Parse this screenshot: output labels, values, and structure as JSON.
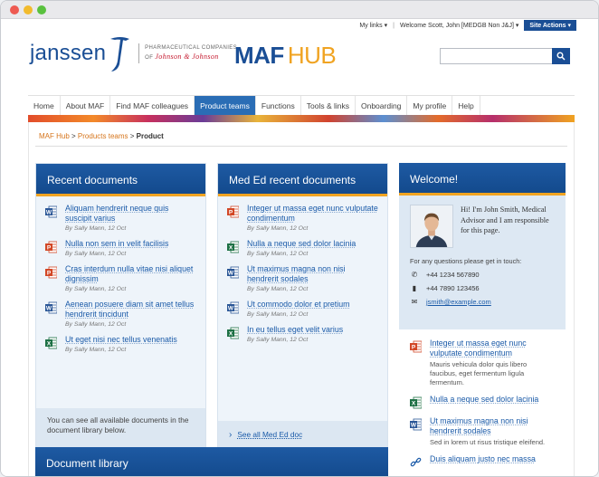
{
  "top": {
    "my_links": "My links ▾",
    "welcome": "Welcome Scott, John [MEDGB Non J&J] ▾",
    "site_actions": "Site Actions ▾"
  },
  "brand": {
    "company": "janssen",
    "pharma_line1": "PHARMACEUTICAL COMPANIES",
    "pharma_of": "OF",
    "jj": "Johnson & Johnson",
    "hub_maf": "MAF",
    "hub_hub": "HUB"
  },
  "search": {
    "placeholder": ""
  },
  "nav": [
    {
      "label": "Home"
    },
    {
      "label": "About MAF"
    },
    {
      "label": "Find MAF colleagues"
    },
    {
      "label": "Product teams"
    },
    {
      "label": "Functions"
    },
    {
      "label": "Tools & links"
    },
    {
      "label": "Onboarding"
    },
    {
      "label": "My profile"
    },
    {
      "label": "Help"
    }
  ],
  "breadcrumb": {
    "home": "MAF Hub",
    "sep1": " > ",
    "section": "Products teams",
    "sep2": " > ",
    "current": "Product"
  },
  "recent": {
    "title": "Recent documents",
    "items": [
      {
        "type": "word",
        "title": "Aliquam hendrerit neque quis suscipit varius",
        "meta": "By Sally Mann, 12 Oct"
      },
      {
        "type": "ppt",
        "title": "Nulla non sem in velit facilisis",
        "meta": "By Sally Mann, 12 Oct"
      },
      {
        "type": "ppt",
        "title": "Cras interdum nulla vitae nisi aliquet dignissim",
        "meta": "By Sally Mann, 12 Oct"
      },
      {
        "type": "word",
        "title": "Aenean posuere diam sit amet tellus hendrerit tincidunt",
        "meta": "By Sally Mann, 12 Oct"
      },
      {
        "type": "excel",
        "title": "Ut eget nisi nec tellus venenatis",
        "meta": "By Sally Mann, 12 Oct"
      }
    ],
    "footer": "You can see all available documents in the document library below."
  },
  "meded": {
    "title": "Med Ed recent documents",
    "items": [
      {
        "type": "ppt",
        "title": "Integer ut massa eget nunc vulputate condimentum",
        "meta": "By Sally Mann, 12 Oct"
      },
      {
        "type": "excel",
        "title": "Nulla a neque sed dolor lacinia",
        "meta": "By Sally Mann, 12 Oct"
      },
      {
        "type": "word",
        "title": "Ut maximus magna non nisi hendrerit sodales",
        "meta": "By Sally Mann, 12 Oct"
      },
      {
        "type": "word",
        "title": "Ut commodo dolor et pretium",
        "meta": "By Sally Mann, 12 Oct"
      },
      {
        "type": "excel",
        "title": "In eu tellus eget velit varius",
        "meta": "By Sally Mann, 12 Oct"
      }
    ],
    "footer_link": "See all Med Ed doc"
  },
  "welcome": {
    "title": "Welcome!",
    "bio": "Hi! I'm John Smith, Medical Advisor and I am responsible for this page.",
    "intro": "For any questions please get in touch:",
    "phone": "+44 1234 567890",
    "mobile": "+44 7890 123456",
    "email": "jsmith@example.com",
    "docs": [
      {
        "type": "ppt",
        "title": "Integer ut massa eget nunc vulputate condimentum",
        "desc": "Mauris vehicula dolor quis libero faucibus, eget fermentum ligula fermentum."
      },
      {
        "type": "excel",
        "title": "Nulla a neque sed dolor lacinia",
        "desc": ""
      },
      {
        "type": "word",
        "title": "Ut maximus magna non nisi hendrerit sodales",
        "desc": "Sed in lorem ut risus tristique eleifend."
      },
      {
        "type": "link",
        "title": "Duis aliquam justo nec massa",
        "desc": ""
      }
    ]
  },
  "library": {
    "title": "Document library"
  },
  "colors": {
    "brand_blue": "#1a4e95",
    "accent_orange": "#f0a321",
    "nav_active": "#2a6db5",
    "link": "#1a5aa8"
  }
}
